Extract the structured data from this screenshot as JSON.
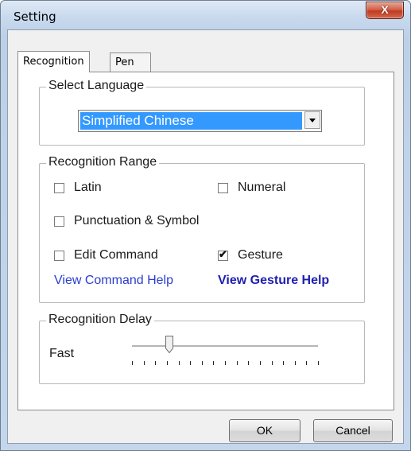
{
  "window": {
    "title": "Setting",
    "close_glyph": "X"
  },
  "tabs": [
    {
      "label": "Recognition",
      "active": true
    },
    {
      "label": "Pen",
      "active": false
    }
  ],
  "select_language": {
    "legend": "Select Language",
    "selected": "Simplified Chinese"
  },
  "recognition_range": {
    "legend": "Recognition Range",
    "options": {
      "latin": {
        "label": "Latin",
        "checked": false
      },
      "numeral": {
        "label": "Numeral",
        "checked": false
      },
      "punctuation": {
        "label": "Punctuation & Symbol",
        "checked": false
      },
      "edit_command": {
        "label": "Edit Command",
        "checked": false
      },
      "gesture": {
        "label": "Gesture",
        "checked": true
      }
    },
    "links": {
      "command_help": "View Command Help",
      "gesture_help": "View Gesture Help"
    }
  },
  "recognition_delay": {
    "legend": "Recognition Delay",
    "min_label": "Fast",
    "tick_count": 17,
    "position_fraction": 0.2
  },
  "buttons": {
    "ok": "OK",
    "cancel": "Cancel"
  },
  "colors": {
    "selection": "#3399ff",
    "link": "#2a3dcf",
    "close_button": "#c23a22"
  },
  "icons": {
    "close": "close-icon",
    "dropdown": "chevron-down-icon",
    "check": "checkmark-icon"
  }
}
